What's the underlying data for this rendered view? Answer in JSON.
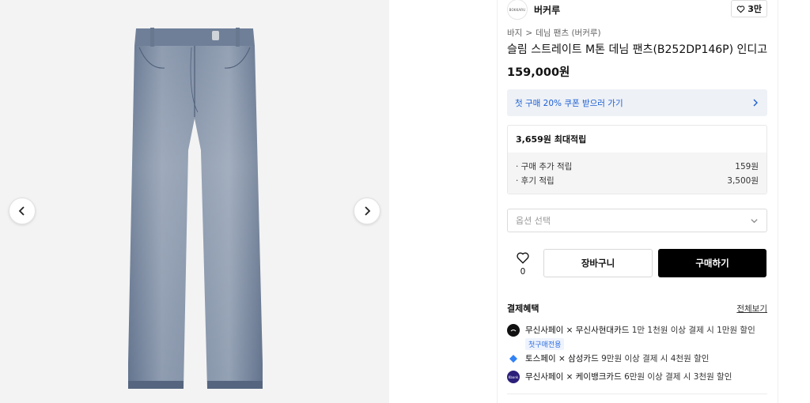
{
  "gallery": {
    "prev_icon": "chevron-left-icon",
    "next_icon": "chevron-right-icon"
  },
  "brand": {
    "logo_text": "BOKKARU",
    "name": "버커루",
    "likes": "3만"
  },
  "breadcrumb": {
    "category": "바지",
    "separator": ">",
    "subcategory": "데님 팬츠 (버커루)"
  },
  "product": {
    "title": "슬림 스트레이트 M톤 데님 팬츠(B252DP146P) 인디고",
    "price": "159,000원"
  },
  "coupon": {
    "text": "첫 구매 20% 쿠폰 받으러 가기"
  },
  "points": {
    "max_label": "3,659원 최대적립",
    "lines": [
      {
        "label": "· 구매 추가 적립",
        "value": "159원"
      },
      {
        "label": "· 후기 적립",
        "value": "3,500원"
      }
    ]
  },
  "option": {
    "placeholder": "옵션 선택"
  },
  "actions": {
    "wish_count": "0",
    "cart_label": "장바구니",
    "buy_label": "구매하기"
  },
  "benefits": {
    "title": "결제혜택",
    "view_all": "전체보기",
    "items": [
      {
        "bold": "무신사페이 × 무신사현대카드",
        "rest": " 1만 1천원 이상 결제 시 1만원 할인",
        "badge": "첫구매전용",
        "icon_color": "#111111"
      },
      {
        "bold": "토스페이 × 삼성카드",
        "rest": " 9만원 이상 결제 시 4천원 할인",
        "icon_color": "#3182f6"
      },
      {
        "bold": "무신사페이 × 케이뱅크카드",
        "rest": " 6만원 이상 결제 시 3천원 할인",
        "icon_text": "Kbank",
        "icon_color": "#2b1f7a"
      }
    ]
  }
}
